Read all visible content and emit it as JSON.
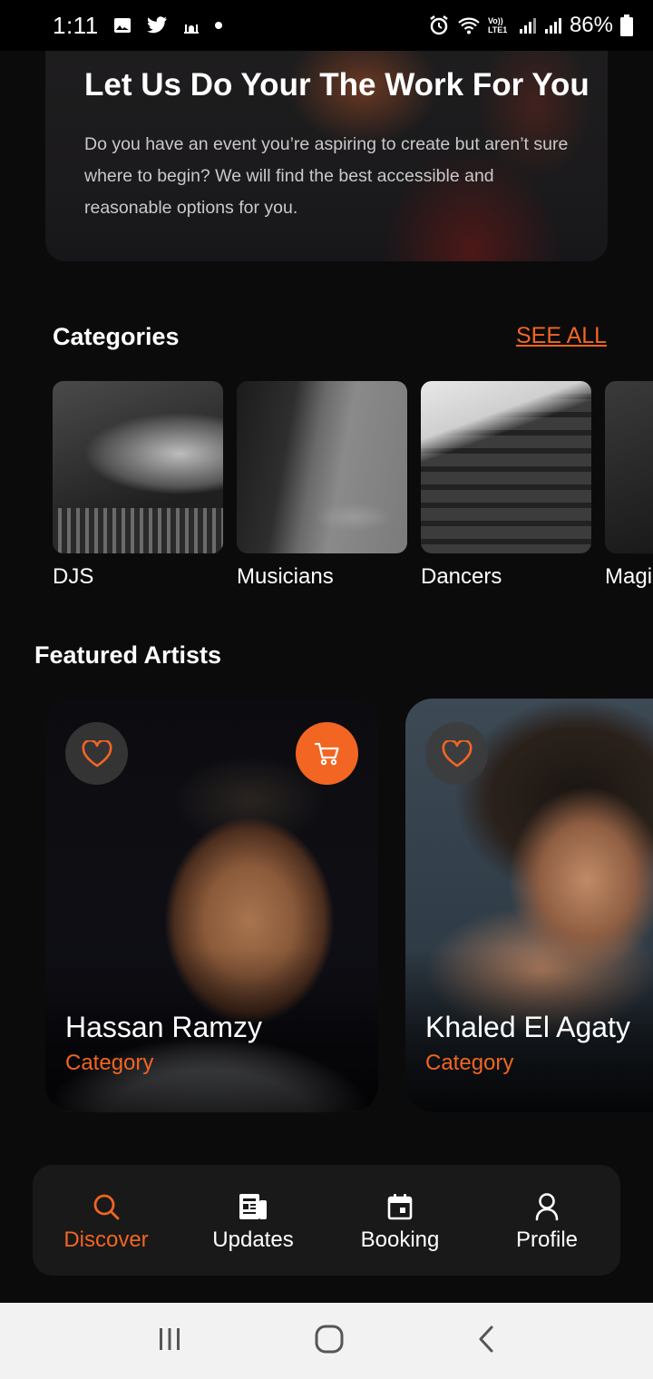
{
  "status_bar": {
    "time": "1:11",
    "lte_label": "Vo)) LTE1",
    "battery": "86%"
  },
  "hero": {
    "title": "Let Us Do Your The Work For You",
    "text": "Do you have an event you’re aspiring to create but aren’t sure where to begin? We will find the best accessible and reasonable options for you."
  },
  "categories": {
    "title": "Categories",
    "see_all": "SEE ALL",
    "items": [
      {
        "label": "DJS"
      },
      {
        "label": "Musicians"
      },
      {
        "label": "Dancers"
      },
      {
        "label": "Magi"
      }
    ]
  },
  "featured": {
    "title": "Featured Artists",
    "artists": [
      {
        "name": "Hassan Ramzy",
        "category": "Category"
      },
      {
        "name": "Khaled El Agaty",
        "category": "Category"
      }
    ]
  },
  "bottom_nav": {
    "items": [
      {
        "label": "Discover",
        "icon": "search-icon",
        "active": true
      },
      {
        "label": "Updates",
        "icon": "newspaper-icon",
        "active": false
      },
      {
        "label": "Booking",
        "icon": "calendar-icon",
        "active": false
      },
      {
        "label": "Profile",
        "icon": "user-icon",
        "active": false
      }
    ]
  },
  "colors": {
    "accent": "#f26522",
    "background": "#0b0b0b",
    "card": "#191919"
  }
}
